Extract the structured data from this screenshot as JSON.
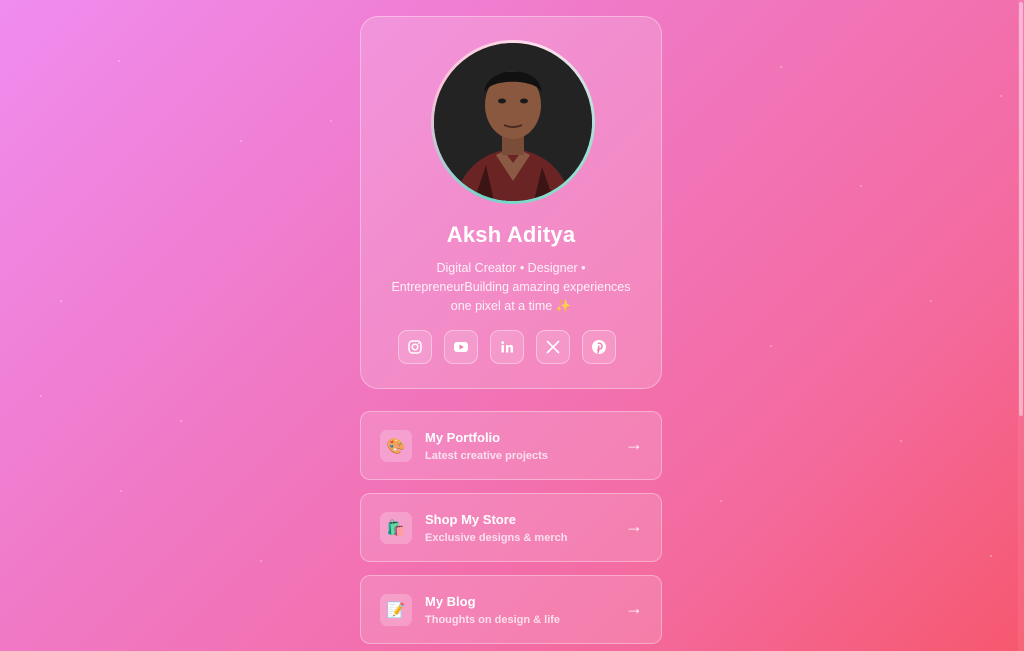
{
  "profile": {
    "name": "Aksh Aditya",
    "bio": "Digital Creator • Designer • EntrepreneurBuilding amazing experiences one pixel at a time ✨"
  },
  "socials": [
    {
      "icon": "instagram-icon",
      "label": "Instagram"
    },
    {
      "icon": "youtube-icon",
      "label": "YouTube"
    },
    {
      "icon": "linkedin-icon",
      "label": "LinkedIn"
    },
    {
      "icon": "x-icon",
      "label": "X"
    },
    {
      "icon": "pinterest-icon",
      "label": "Pinterest"
    }
  ],
  "links": [
    {
      "emoji": "🎨",
      "icon": "palette-icon",
      "title": "My Portfolio",
      "subtitle": "Latest creative projects",
      "arrow": "→"
    },
    {
      "emoji": "🛍️",
      "icon": "shopping-bag-icon",
      "title": "Shop My Store",
      "subtitle": "Exclusive designs & merch",
      "arrow": "→"
    },
    {
      "emoji": "📝",
      "icon": "memo-icon",
      "title": "My Blog",
      "subtitle": "Thoughts on design & life",
      "arrow": "→"
    }
  ],
  "colors": {
    "gradient_start": "#f08cf0",
    "gradient_end": "#f6586e",
    "avatar_ring": "#6fd6c8"
  }
}
